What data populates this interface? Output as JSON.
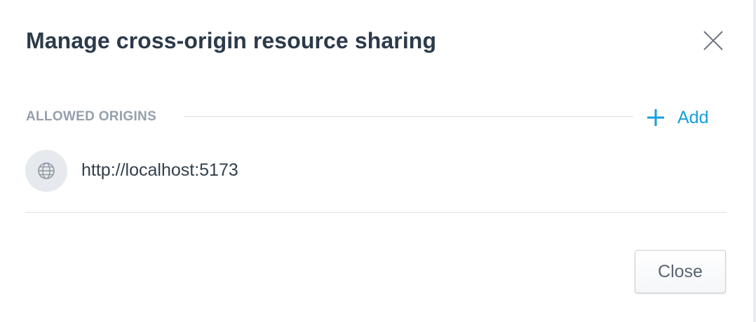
{
  "dialog": {
    "title": "Manage cross-origin resource sharing",
    "close_icon": "close-icon"
  },
  "section": {
    "label": "ALLOWED ORIGINS",
    "add_label": "Add",
    "add_icon": "plus-icon"
  },
  "origins": [
    {
      "icon": "globe-icon",
      "url": "http://localhost:5173"
    }
  ],
  "footer": {
    "close_label": "Close"
  },
  "colors": {
    "accent": "#14a0dc",
    "title": "#2c3a4a",
    "section_label": "#94a0ab"
  }
}
